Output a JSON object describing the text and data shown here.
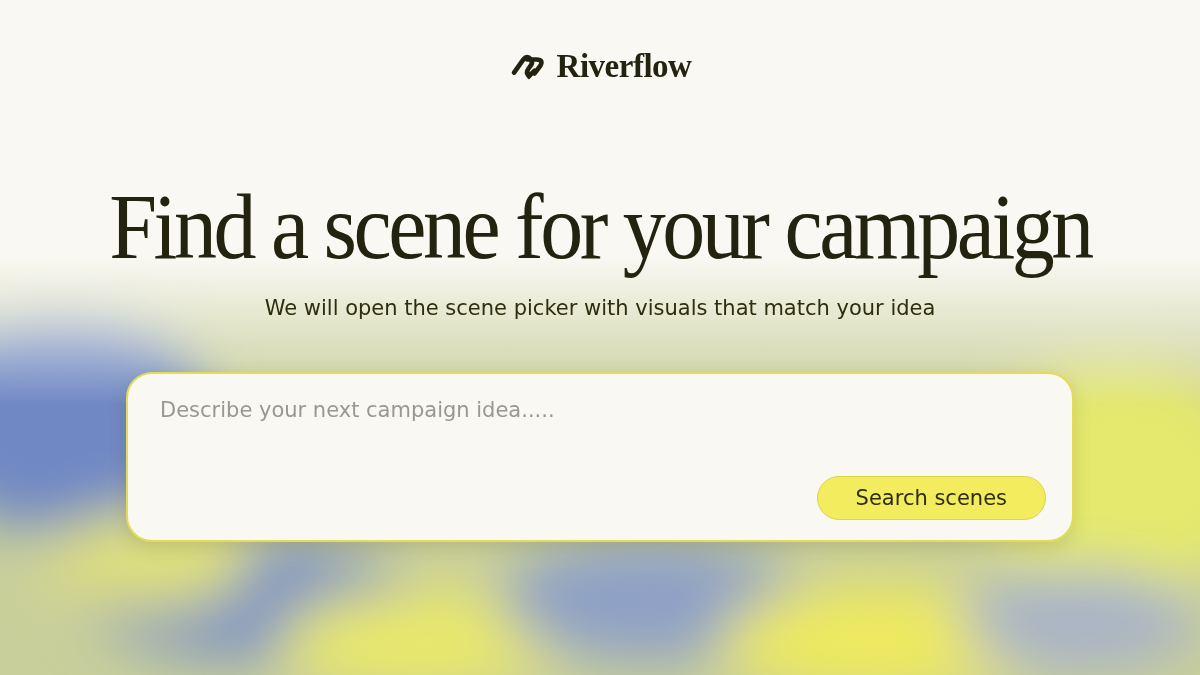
{
  "brand": {
    "name": "Riverflow"
  },
  "headline": "Find a scene for your campaign",
  "subtitle": "We will open the scene picker with visuals that match your idea",
  "prompt": {
    "placeholder": "Describe your next campaign idea.....",
    "button": "Search scenes"
  }
}
